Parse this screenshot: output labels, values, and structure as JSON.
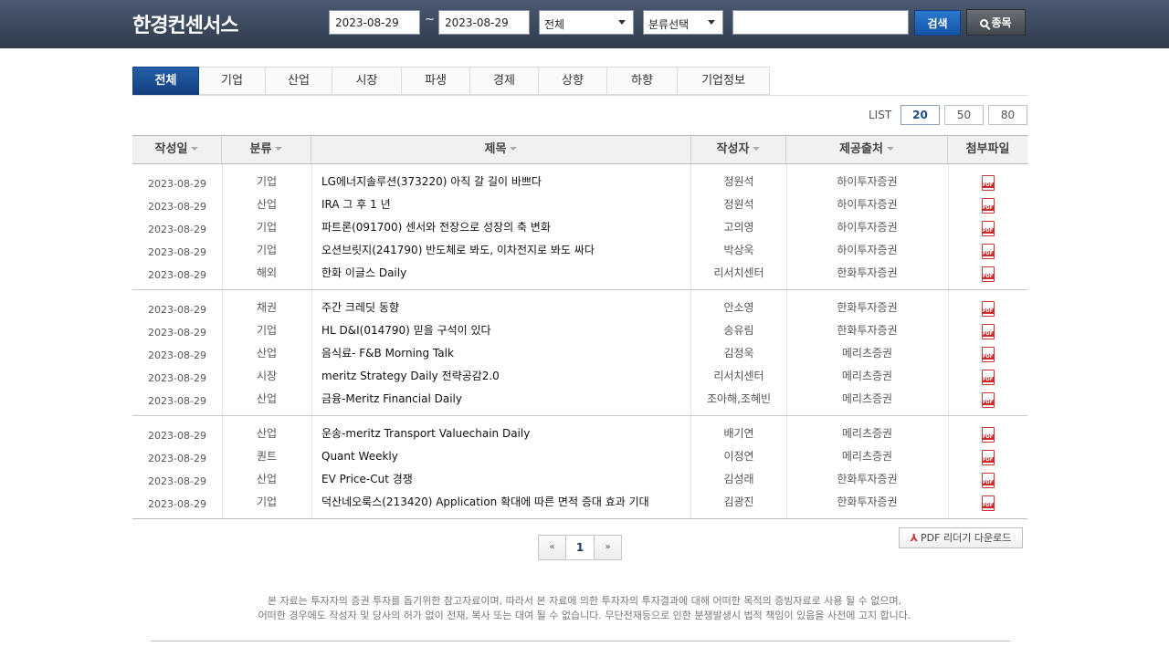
{
  "header": {
    "logo": "한경컨센서스",
    "date_from": "2023-08-29",
    "date_to": "2023-08-29",
    "tilde": "~",
    "select_all": "전체",
    "select_category": "분류선택",
    "search_placeholder": "",
    "search_button": "검색",
    "stock_button": "종목"
  },
  "tabs": [
    {
      "label": "전체",
      "active": true
    },
    {
      "label": "기업"
    },
    {
      "label": "산업"
    },
    {
      "label": "시장"
    },
    {
      "label": "파생"
    },
    {
      "label": "경제"
    },
    {
      "label": "상향"
    },
    {
      "label": "하향"
    },
    {
      "label": "기업정보"
    }
  ],
  "list": {
    "label": "LIST",
    "options": [
      "20",
      "50",
      "80"
    ],
    "selected": "20"
  },
  "table": {
    "headers": [
      "작성일",
      "분류",
      "제목",
      "작성자",
      "제공출처",
      "첨부파일"
    ],
    "rows": [
      {
        "date": "2023-08-29",
        "category": "기업",
        "title": "LG에너지솔루션(373220) 아직 갈 길이 바쁘다",
        "author": "정원석",
        "source": "하이투자증권"
      },
      {
        "date": "2023-08-29",
        "category": "산업",
        "title": "IRA 그 후 1 년",
        "author": "정원석",
        "source": "하이투자증권"
      },
      {
        "date": "2023-08-29",
        "category": "기업",
        "title": "파트론(091700) 센서와 전장으로 성장의 축 변화",
        "author": "고의영",
        "source": "하이투자증권"
      },
      {
        "date": "2023-08-29",
        "category": "기업",
        "title": "오션브릿지(241790) 반도체로 봐도, 이차전지로 봐도 싸다",
        "author": "박상욱",
        "source": "하이투자증권"
      },
      {
        "date": "2023-08-29",
        "category": "해외",
        "title": "한화 이글스 Daily",
        "author": "리서치센터",
        "source": "한화투자증권"
      },
      {
        "date": "2023-08-29",
        "category": "채권",
        "title": "주간 크레딧 동향",
        "author": "안소영",
        "source": "한화투자증권"
      },
      {
        "date": "2023-08-29",
        "category": "기업",
        "title": "HL D&I(014790) 믿을 구석이 있다",
        "author": "송유림",
        "source": "한화투자증권"
      },
      {
        "date": "2023-08-29",
        "category": "산업",
        "title": "음식료- F&B Morning Talk",
        "author": "김정욱",
        "source": "메리츠증권"
      },
      {
        "date": "2023-08-29",
        "category": "시장",
        "title": "meritz Strategy Daily 전략공감2.0",
        "author": "리서치센터",
        "source": "메리츠증권"
      },
      {
        "date": "2023-08-29",
        "category": "산업",
        "title": "금융-Meritz Financial Daily",
        "author": "조아해,조혜빈",
        "source": "메리츠증권"
      },
      {
        "date": "2023-08-29",
        "category": "산업",
        "title": "운송-meritz Transport Valuechain Daily",
        "author": "배기연",
        "source": "메리츠증권"
      },
      {
        "date": "2023-08-29",
        "category": "퀀트",
        "title": "Quant Weekly",
        "author": "이정연",
        "source": "메리츠증권"
      },
      {
        "date": "2023-08-29",
        "category": "산업",
        "title": "EV Price-Cut 경쟁",
        "author": "김성래",
        "source": "한화투자증권"
      },
      {
        "date": "2023-08-29",
        "category": "기업",
        "title": "덕산네오룩스(213420) Application 확대에 따른 면적 증대 효과 기대",
        "author": "김광진",
        "source": "한화투자증권"
      }
    ]
  },
  "pagination": {
    "prev": "«",
    "page": "1",
    "next": "»"
  },
  "pdf_reader_button": "PDF 리더기 다운로드",
  "footer": {
    "line1": "본 자료는 투자자의 증권 투자를 돕기위한 참고자료이며, 따라서 본 자료에 의한 투자자의 투자결과에 대해 어떠한 목적의 증빙자료로 사용 될 수 없으며,",
    "line2": "어떠한 경우에도 작성자 및 당사의 허가 없이 전재, 복사 또는 대여 될 수 없습니다. 무단전재등으로 인한 분쟁발생시 법적 책임이 있음을 사전에 고지 합니다."
  },
  "colors": {
    "header_bg": "#3a4759",
    "active_tab": "#1a4e94",
    "search_button": "#1e66bc"
  }
}
